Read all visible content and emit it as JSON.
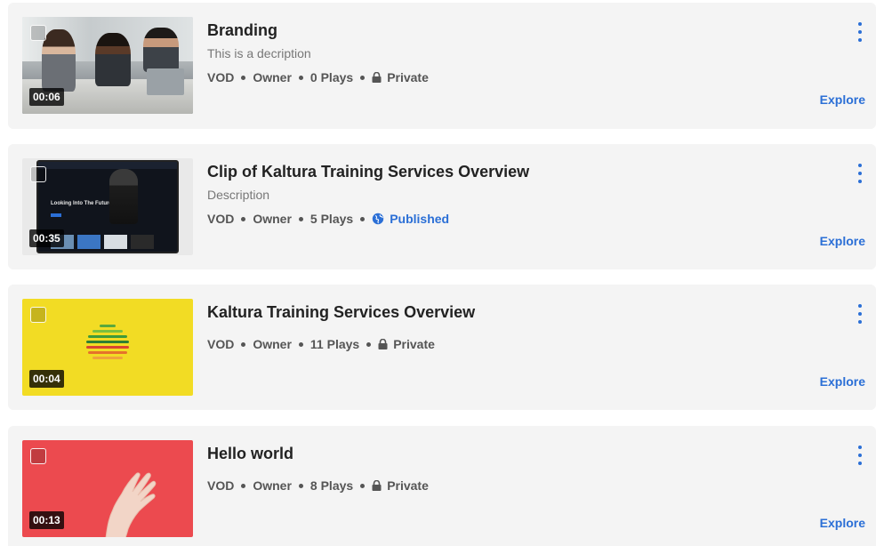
{
  "items": [
    {
      "title": "Branding",
      "description": "This is a decription",
      "duration": "00:06",
      "type": "VOD",
      "role": "Owner",
      "plays": "0 Plays",
      "status": "Private",
      "status_icon": "lock-icon",
      "explore_label": "Explore"
    },
    {
      "title": "Clip of Kaltura Training Services Overview",
      "description": "Description",
      "duration": "00:35",
      "type": "VOD",
      "role": "Owner",
      "plays": "5 Plays",
      "status": "Published",
      "status_icon": "globe-icon",
      "explore_label": "Explore",
      "thumb_text": "Looking Into The Future"
    },
    {
      "title": "Kaltura Training Services Overview",
      "duration": "00:04",
      "type": "VOD",
      "role": "Owner",
      "plays": "11 Plays",
      "status": "Private",
      "status_icon": "lock-icon",
      "explore_label": "Explore"
    },
    {
      "title": "Hello world",
      "duration": "00:13",
      "type": "VOD",
      "role": "Owner",
      "plays": "8 Plays",
      "status": "Private",
      "status_icon": "lock-icon",
      "explore_label": "Explore"
    }
  ],
  "colors": {
    "accent": "#2b6fd6",
    "card_background": "#f4f4f4",
    "thumb_yellow": "#f2dc24",
    "thumb_red": "#ec4a4f"
  }
}
